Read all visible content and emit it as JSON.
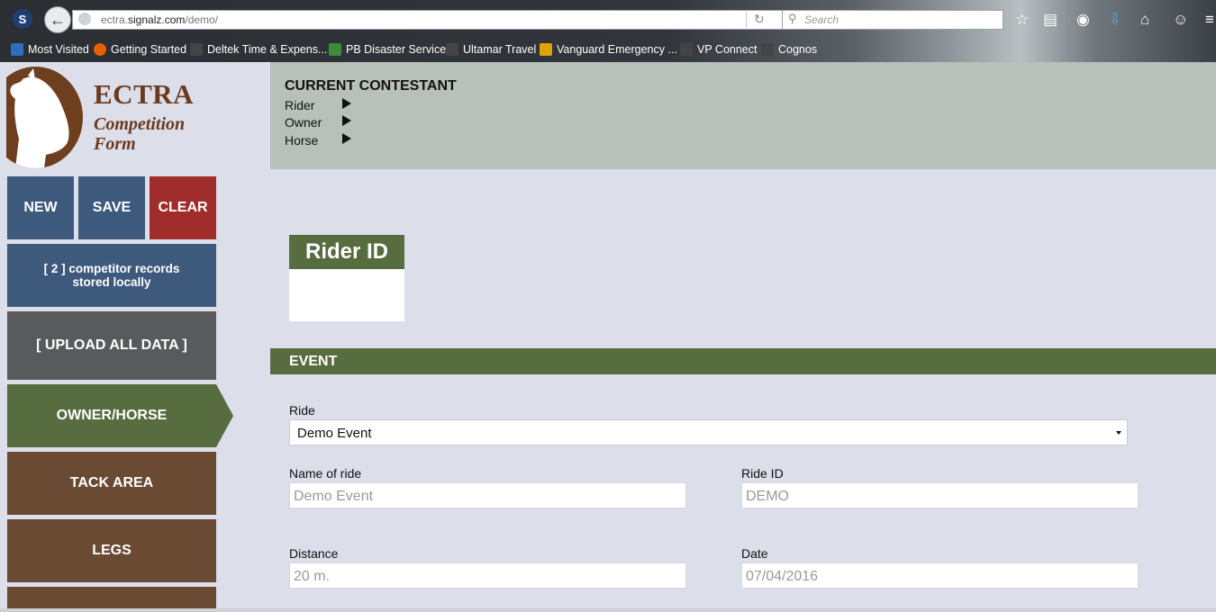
{
  "browser": {
    "url_host": "ectra.signalz.com/demo/",
    "url_prefix": "ectra.",
    "url_domain": "signalz.com",
    "url_path": "/demo/",
    "search_placeholder": "Search",
    "bookmarks": [
      {
        "label": "Most Visited",
        "icon_color": "#2d6fbf"
      },
      {
        "label": "Getting Started",
        "icon_color": "#e66000"
      },
      {
        "label": "Deltek Time & Expens...",
        "icon_color": "#444444"
      },
      {
        "label": "PB Disaster Services",
        "icon_color": "#3c8a3c"
      },
      {
        "label": "Ultamar Travel",
        "icon_color": "#444444"
      },
      {
        "label": "Vanguard Emergency ...",
        "icon_color": "#e0a400"
      },
      {
        "label": "VP Connect",
        "icon_color": "#444444"
      },
      {
        "label": "Cognos",
        "icon_color": "#444444"
      }
    ]
  },
  "brand": {
    "title": "ECTRA",
    "subtitle_line1": "Competition",
    "subtitle_line2": "Form"
  },
  "sidebar": {
    "new_label": "NEW",
    "save_label": "SAVE",
    "clear_label": "CLEAR",
    "records_label": "[ 2 ] competitor records stored locally",
    "upload_label": "[ UPLOAD ALL DATA ]",
    "owner_horse_label": "OWNER/HORSE",
    "tack_area_label": "TACK AREA",
    "legs_label": "LEGS"
  },
  "contestant": {
    "title": "CURRENT CONTESTANT",
    "rider_label": "Rider",
    "owner_label": "Owner",
    "horse_label": "Horse"
  },
  "rider_id": {
    "heading": "Rider ID"
  },
  "event": {
    "heading": "EVENT",
    "ride_label": "Ride",
    "ride_value": "Demo Event",
    "name_label": "Name of ride",
    "name_value": "Demo Event",
    "ride_id_label": "Ride ID",
    "ride_id_value": "DEMO",
    "distance_label": "Distance",
    "distance_value": "20 m.",
    "date_label": "Date",
    "date_value": "07/04/2016"
  },
  "colors": {
    "navy": "#3d5a7d",
    "red": "#a02c2c",
    "green": "#576c3f",
    "brown": "#6a4a33",
    "gray": "#595a5c"
  }
}
